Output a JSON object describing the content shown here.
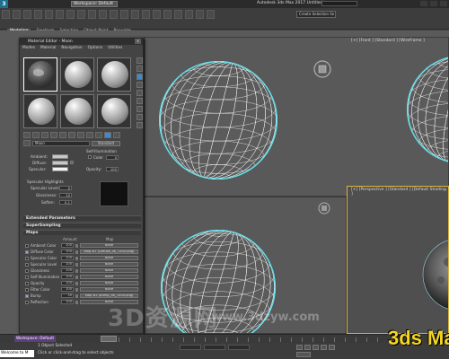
{
  "app": {
    "logo_letter": "3",
    "workspace": "Workspace: Default",
    "menus": [
      "Customize",
      "Scripting",
      "Animation",
      "Graph Editors",
      "Rendering",
      "Civil View",
      "Customize",
      "Scripting",
      "Help"
    ],
    "window_title": "Autodesk 3ds Max 2017    Untitled",
    "selection_set": "Create Selection Se"
  },
  "ribbon": {
    "tabs": [
      "Modeling",
      "Freeform",
      "Selection",
      "Object Paint",
      "Populate"
    ],
    "active_tab": "Modeling",
    "sub_tabs": [
      "Edge",
      "Properties"
    ]
  },
  "viewports": {
    "top_right_label": "[+] [Front ] [Standard ] [Wireframe ]",
    "perspective_label": "[+] [Perspective ] [Standard ] [Default Shading ]",
    "wire_color": "#ffffff",
    "selection_color": "#5fe0ea",
    "active_border": "#d9b23a"
  },
  "material_editor": {
    "title": "Material Editor - Moon",
    "close": "x",
    "menu": [
      "Modes",
      "Material",
      "Navigation",
      "Options",
      "Utilities"
    ],
    "material_name": "Moon",
    "material_type": "Standard",
    "self_illumination_label": "Self-Illumination",
    "color_label": "Color",
    "color_value": "0",
    "opacity_label": "Opacity:",
    "opacity_value": "100",
    "ambient_label": "Ambient:",
    "diffuse_label": "Diffuse:",
    "specular_label": "Specular:",
    "specular_highlights_label": "Specular Highlights",
    "specular_level_label": "Specular Level:",
    "specular_level_value": "0",
    "glossiness_label": "Glossiness:",
    "glossiness_value": "10",
    "soften_label": "Soften:",
    "soften_value": "0.1",
    "rollouts": [
      "Extended Parameters",
      "SuperSampling",
      "Maps"
    ],
    "maps_header": {
      "amount": "Amount",
      "map": "Map"
    },
    "maps": [
      {
        "name": "Ambient Color",
        "amount": "100",
        "map": "None",
        "checked": false
      },
      {
        "name": "Diffuse Color",
        "amount": "100",
        "map": "Map #1 (Diffuse_4K_1500.png)",
        "checked": true
      },
      {
        "name": "Specular Color",
        "amount": "100",
        "map": "None",
        "checked": false
      },
      {
        "name": "Specular Level",
        "amount": "100",
        "map": "None",
        "checked": false
      },
      {
        "name": "Glossiness",
        "amount": "100",
        "map": "None",
        "checked": false
      },
      {
        "name": "Self-Illumination",
        "amount": "100",
        "map": "None",
        "checked": false
      },
      {
        "name": "Opacity",
        "amount": "100",
        "map": "None",
        "checked": false
      },
      {
        "name": "Filter Color",
        "amount": "100",
        "map": "None",
        "checked": false
      },
      {
        "name": "Bump",
        "amount": "30",
        "map": "Map #2 (Bump_4K_1500.png)",
        "checked": true
      },
      {
        "name": "Reflection",
        "amount": "100",
        "map": "None",
        "checked": false
      }
    ]
  },
  "timeline": {
    "workspace": "Workspace: Default"
  },
  "status": {
    "welcome": "Welcome to M",
    "line1": "1 Object Selected",
    "line2": "Click or click-and-drag to select objects"
  },
  "watermark": {
    "cn": "3D资源网",
    "url": "www.3dzyw.com"
  },
  "brand": "3ds Max"
}
